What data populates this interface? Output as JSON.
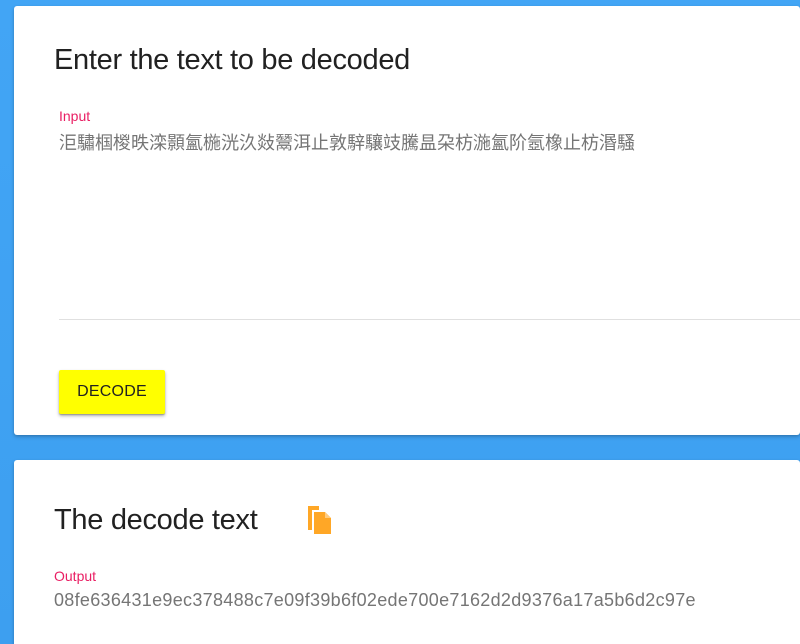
{
  "input_card": {
    "title": "Enter the text to be decoded",
    "label": "Input",
    "value": "洰驌椢椶昳滦顥氳椸洸汣敥鬵洱止敦騂驤攱騰昷朶枋湤氳阶氬橡止枋湣騷",
    "button_label": "DECODE"
  },
  "output_card": {
    "title": "The decode text",
    "label": "Output",
    "value": "08fe636431e9ec378488c7e09f39b6f02ede700e7162d2d9376a17a5b6d2c97e",
    "copy_icon": "copy-icon"
  },
  "colors": {
    "background": "#42a5f5",
    "label_accent": "#e91e63",
    "button": "#ffff00",
    "copy_icon": "#ffa726"
  }
}
